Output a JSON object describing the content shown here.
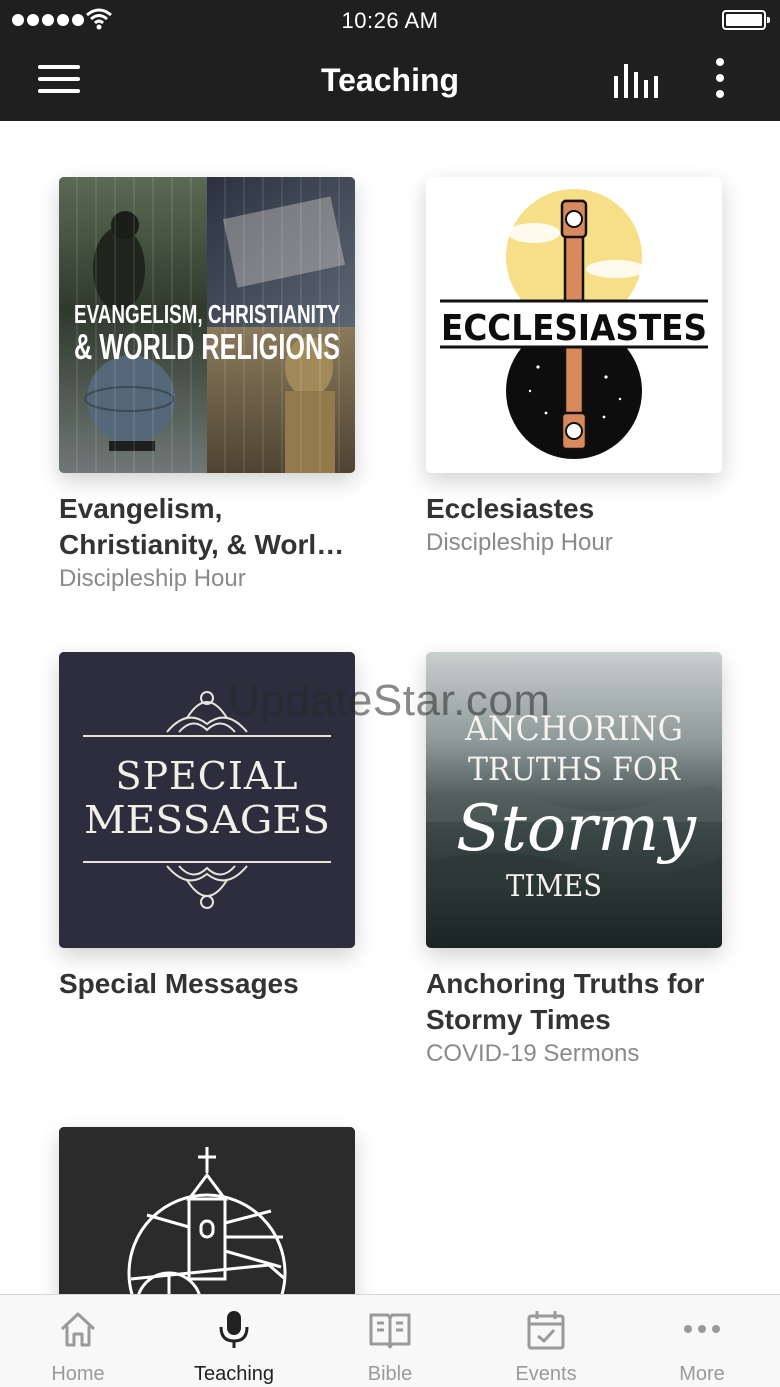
{
  "status_bar": {
    "time": "10:26 AM"
  },
  "nav": {
    "title": "Teaching"
  },
  "items": [
    {
      "art_text": [
        "EVANGELISM, CHRISTIANITY",
        "& WORLD RELIGIONS"
      ],
      "title": "Evangelism, Christianity, & World Religions",
      "subtitle": "Discipleship Hour"
    },
    {
      "art_text": [
        "ECCLESIASTES"
      ],
      "title": "Ecclesiastes",
      "subtitle": "Discipleship Hour"
    },
    {
      "art_text": [
        "SPECIAL",
        "MESSAGES"
      ],
      "title": "Special Messages",
      "subtitle": ""
    },
    {
      "art_text": [
        "ANCHORING",
        "TRUTHS FOR",
        "Stormy",
        "TIMES"
      ],
      "title": "Anchoring Truths for Stormy Times",
      "subtitle": "COVID-19 Sermons"
    },
    {
      "art_text": [],
      "title": "",
      "subtitle": ""
    }
  ],
  "watermark": "UpdateStar.com",
  "tabs": [
    {
      "label": "Home",
      "icon": "home-icon"
    },
    {
      "label": "Teaching",
      "icon": "microphone-icon",
      "active": true
    },
    {
      "label": "Bible",
      "icon": "book-icon"
    },
    {
      "label": "Events",
      "icon": "calendar-icon"
    },
    {
      "label": "More",
      "icon": "more-icon"
    }
  ],
  "colors": {
    "bar": "#1f1f1f",
    "tab_active": "#222222",
    "tab_inactive": "#9a9a9a"
  }
}
